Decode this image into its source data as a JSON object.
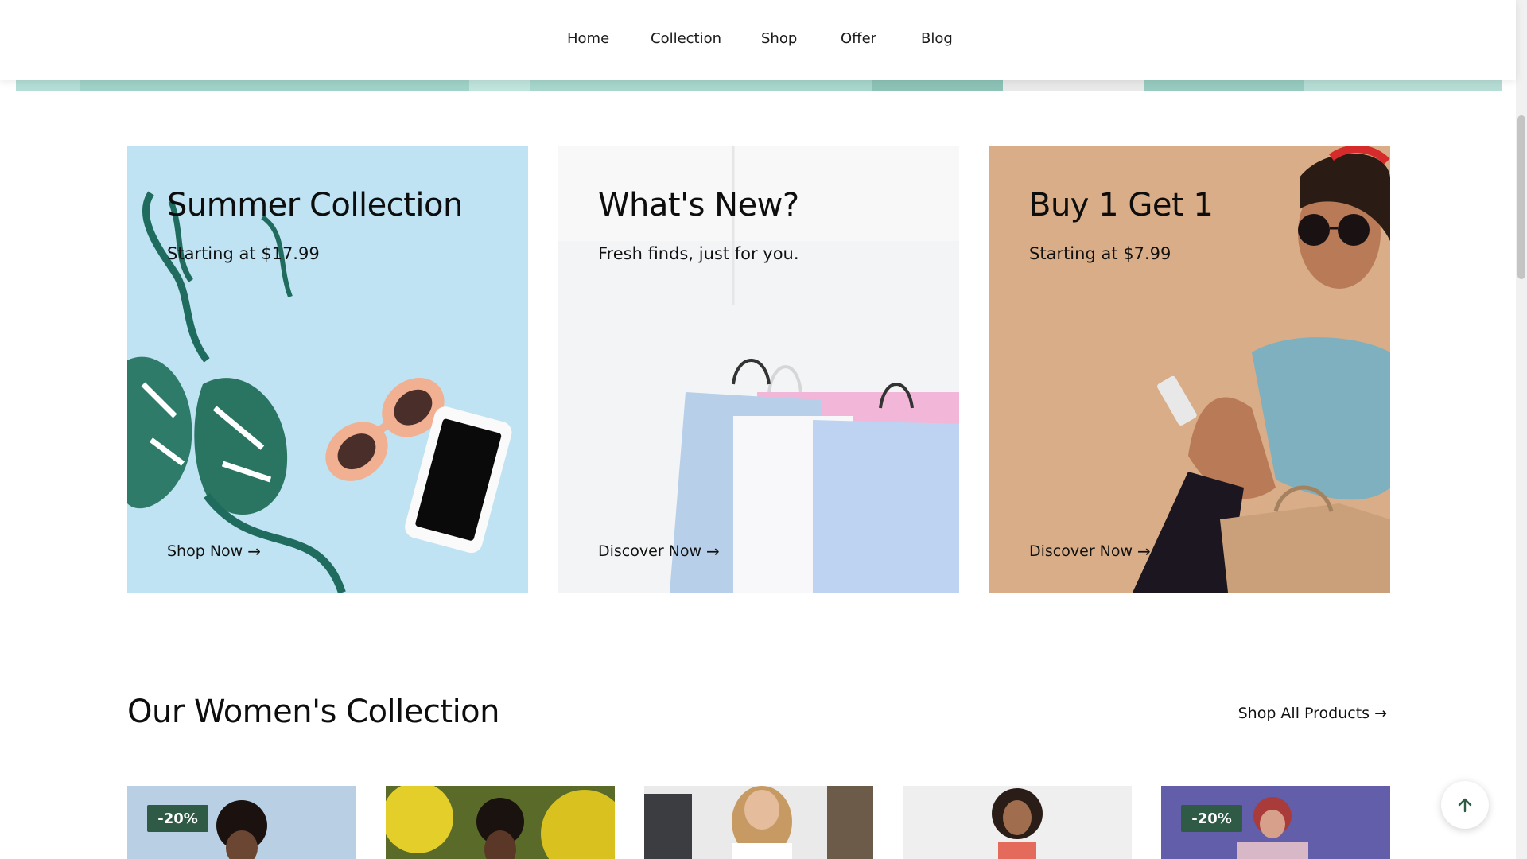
{
  "nav": {
    "items": [
      {
        "label": "Home"
      },
      {
        "label": "Collection"
      },
      {
        "label": "Shop"
      },
      {
        "label": "Offer"
      },
      {
        "label": "Blog"
      }
    ]
  },
  "promos": [
    {
      "title": "Summer Collection",
      "subtitle": "Starting at $17.99",
      "cta": "Shop Now",
      "bg": "#bfe3f2"
    },
    {
      "title": "What's New?",
      "subtitle": "Fresh finds, just for you.",
      "cta": "Discover Now",
      "bg": "#f3f4f5"
    },
    {
      "title": "Buy 1 Get 1",
      "subtitle": "Starting at $7.99",
      "cta": "Discover Now",
      "bg": "#d8ab84"
    }
  ],
  "section": {
    "title": "Our Women's Collection",
    "shop_all": "Shop All Products"
  },
  "products": [
    {
      "badge": "-20%",
      "bg": "#b6cde0"
    },
    {
      "badge": "",
      "bg": "#5b6b2a"
    },
    {
      "badge": "",
      "bg": "#e8e8e8"
    },
    {
      "badge": "",
      "bg": "#efefef"
    },
    {
      "badge": "-20%",
      "bg": "#5e5aa8"
    }
  ],
  "icons": {
    "arrow_right": "arrow-right-icon",
    "arrow_up": "arrow-up-icon"
  },
  "colors": {
    "badge": "#2f5a46",
    "hero_teal": "#a9d7cf"
  }
}
